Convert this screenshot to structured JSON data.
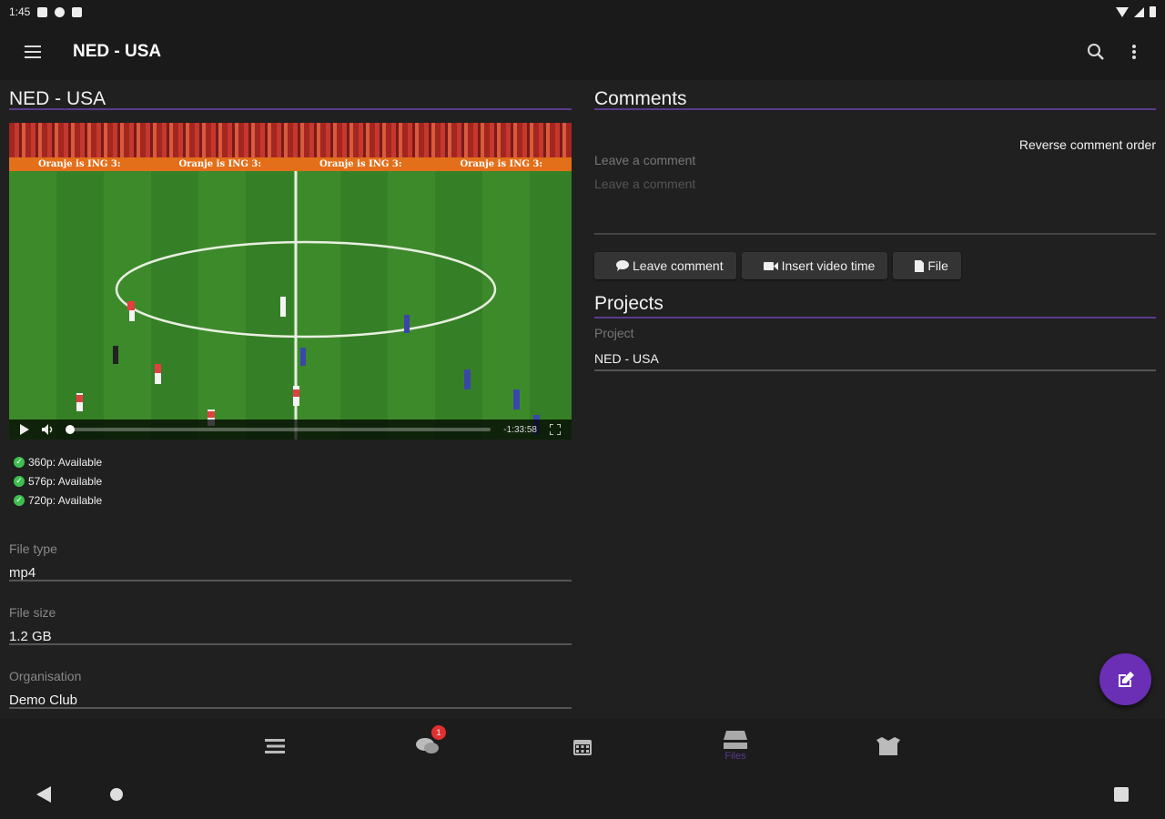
{
  "status_bar": {
    "time": "1:45"
  },
  "app_bar": {
    "title": "NED - USA"
  },
  "file": {
    "title": "NED - USA",
    "video": {
      "banner_text": "Oranje is ING 3:",
      "time_remaining": "-1:33:58",
      "progress": 0.0
    },
    "qualities": [
      {
        "label": "360p: Available"
      },
      {
        "label": "576p: Available"
      },
      {
        "label": "720p: Available"
      }
    ],
    "fields": {
      "file_type_label": "File type",
      "file_type_value": "mp4",
      "file_size_label": "File size",
      "file_size_value": "1.2 GB",
      "organisation_label": "Organisation",
      "organisation_value": "Demo Club"
    }
  },
  "comments": {
    "title": "Comments",
    "reverse_label": "Reverse comment order",
    "field_label": "Leave a comment",
    "placeholder": "Leave a comment",
    "buttons": {
      "leave_comment": "Leave comment",
      "insert_video_time": "Insert video time",
      "file": "File"
    }
  },
  "projects": {
    "title": "Projects",
    "field_label": "Project",
    "field_value": "NED - USA"
  },
  "bottom_nav": {
    "chat_badge": "1",
    "files_label": "Files",
    "active": "files"
  },
  "colors": {
    "accent": "#6a2fb5",
    "divider_accent": "#5b3a8c",
    "available": "#3fbf4f",
    "badge": "#e03030"
  }
}
